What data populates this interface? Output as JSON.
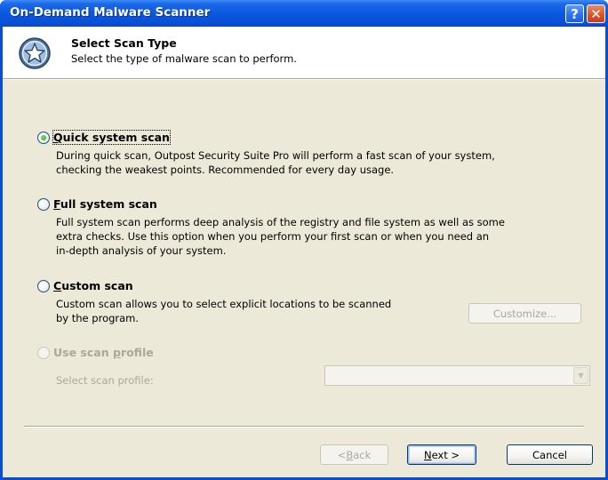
{
  "window": {
    "title": "On-Demand Malware Scanner"
  },
  "titlebar_buttons": {
    "help": "?",
    "close": "✕"
  },
  "header": {
    "title": "Select Scan Type",
    "subtitle": "Select the type of malware scan to perform.",
    "icon": "scanner-shield-icon"
  },
  "options": [
    {
      "mnemonic": "Q",
      "label_rest": "uick system scan",
      "checked": true,
      "enabled": true,
      "description": [
        "During quick scan, Outpost Security Suite Pro will perform a fast scan of your system,",
        "checking the weakest points. Recommended for every day usage."
      ]
    },
    {
      "mnemonic": "F",
      "label_rest": "ull system scan",
      "checked": false,
      "enabled": true,
      "description": [
        "Full system scan performs deep analysis of the registry and file system as well as some",
        "extra checks. Use this option when you perform your first scan or when you need an",
        "in-depth analysis of your system."
      ]
    },
    {
      "mnemonic": "C",
      "label_rest": "ustom scan",
      "checked": false,
      "enabled": true,
      "description": [
        "Custom scan allows you to select explicit locations to be scanned",
        "by the program."
      ]
    },
    {
      "label_prefix": "Use scan ",
      "mnemonic": "p",
      "label_rest": "rofile",
      "checked": false,
      "enabled": false
    }
  ],
  "customize_button": "Customize...",
  "profile": {
    "label": "Select scan profile:",
    "value": ""
  },
  "footer": {
    "back_mnemonic": "B",
    "back_rest": "ack",
    "back_prefix": "< ",
    "next_mnemonic": "N",
    "next_rest": "ext >",
    "cancel": "Cancel"
  },
  "colors": {
    "titlebar": "#0a58dc",
    "client": "#ece9d8",
    "header": "#ffffff"
  }
}
